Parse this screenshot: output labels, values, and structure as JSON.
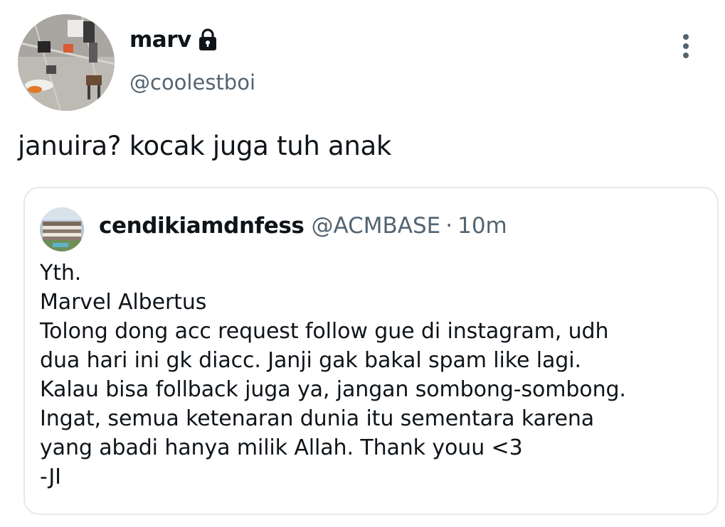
{
  "tweet": {
    "author": {
      "display_name": "marv",
      "handle": "@coolestboi",
      "avatar_icon": "profile-photo",
      "protected_icon": "lock-icon"
    },
    "text": "januira? kocak juga tuh anak",
    "more_icon": "more-vertical-icon"
  },
  "quote": {
    "author": {
      "display_name": "cendikiamdnfess",
      "handle": "@ACMBASE",
      "separator": "·",
      "time": "10m",
      "avatar_icon": "building-photo"
    },
    "lines": [
      "Yth.",
      "Marvel Albertus",
      "Tolong dong acc request follow gue di instagram, udh",
      "dua hari ini gk diacc. Janji gak bakal spam like lagi.",
      "Kalau bisa follback juga ya, jangan sombong-sombong.",
      "Ingat, semua ketenaran dunia itu sementara karena",
      "yang abadi hanya milik Allah. Thank youu <3",
      "-JI"
    ]
  },
  "colors": {
    "text_primary": "#0f1419",
    "text_secondary": "#536471",
    "border": "#e6e9eb",
    "background": "#ffffff"
  }
}
